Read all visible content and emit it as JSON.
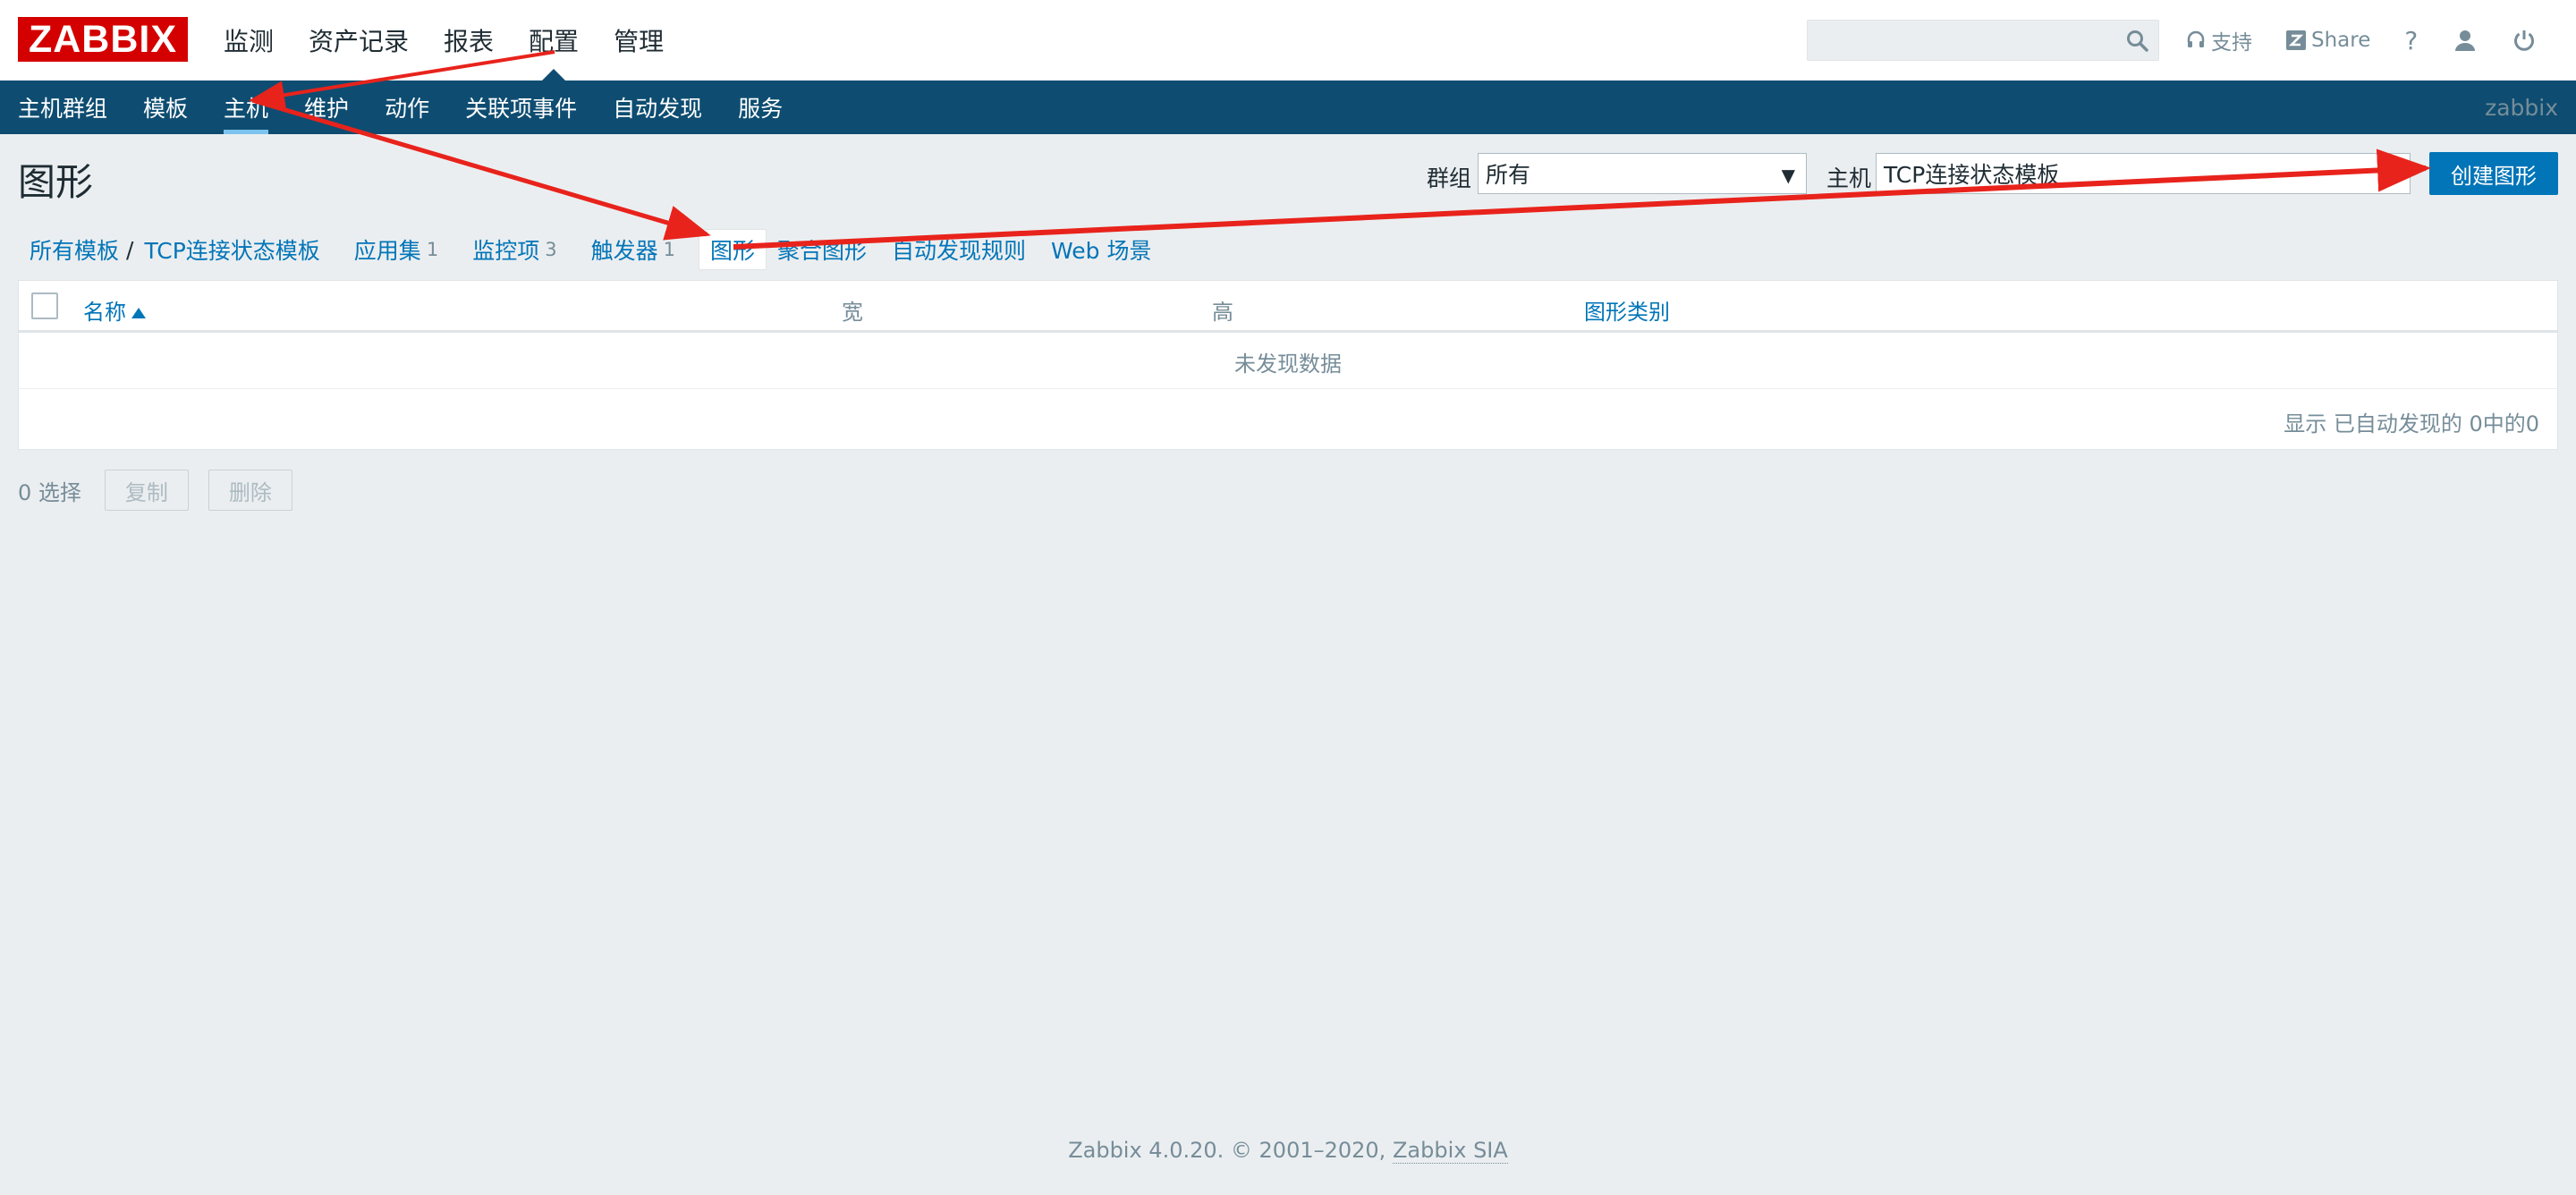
{
  "header": {
    "logo_text": "ZABBIX",
    "main_menu": [
      "监测",
      "资产记录",
      "报表",
      "配置",
      "管理"
    ],
    "search": {
      "value": "",
      "placeholder": ""
    },
    "support_label": "支持",
    "share_label": "Share",
    "help_label": "?"
  },
  "subnav": {
    "items": [
      "主机群组",
      "模板",
      "主机",
      "维护",
      "动作",
      "关联项事件",
      "自动发现",
      "服务"
    ],
    "server_name": "zabbix"
  },
  "page": {
    "title": "图形",
    "filter": {
      "group_label": "群组",
      "group_value": "所有",
      "host_label": "主机",
      "host_value": "TCP连接状态模板"
    },
    "create_button": "创建图形"
  },
  "tabs": {
    "all_templates": "所有模板",
    "separator": "/",
    "template": "TCP连接状态模板",
    "applications": {
      "label": "应用集",
      "count": "1"
    },
    "items": {
      "label": "监控项",
      "count": "3"
    },
    "triggers": {
      "label": "触发器",
      "count": "1"
    },
    "graphs": "图形",
    "screens": "聚合图形",
    "discovery": "自动发现规则",
    "web": "Web 场景"
  },
  "table": {
    "columns": [
      "名称",
      "宽",
      "高",
      "图形类别"
    ],
    "empty_message": "未发现数据",
    "paging": "显示 已自动发现的 0中的0"
  },
  "actions": {
    "selected": "0 选择",
    "copy": "复制",
    "delete": "删除"
  },
  "footer": {
    "text": "Zabbix 4.0.20. © 2001–2020,",
    "link": "Zabbix SIA"
  },
  "colors": {
    "brand": "#d40000",
    "nav": "#0e4d71",
    "link": "#0275b8",
    "annotation": "#e8231c"
  }
}
